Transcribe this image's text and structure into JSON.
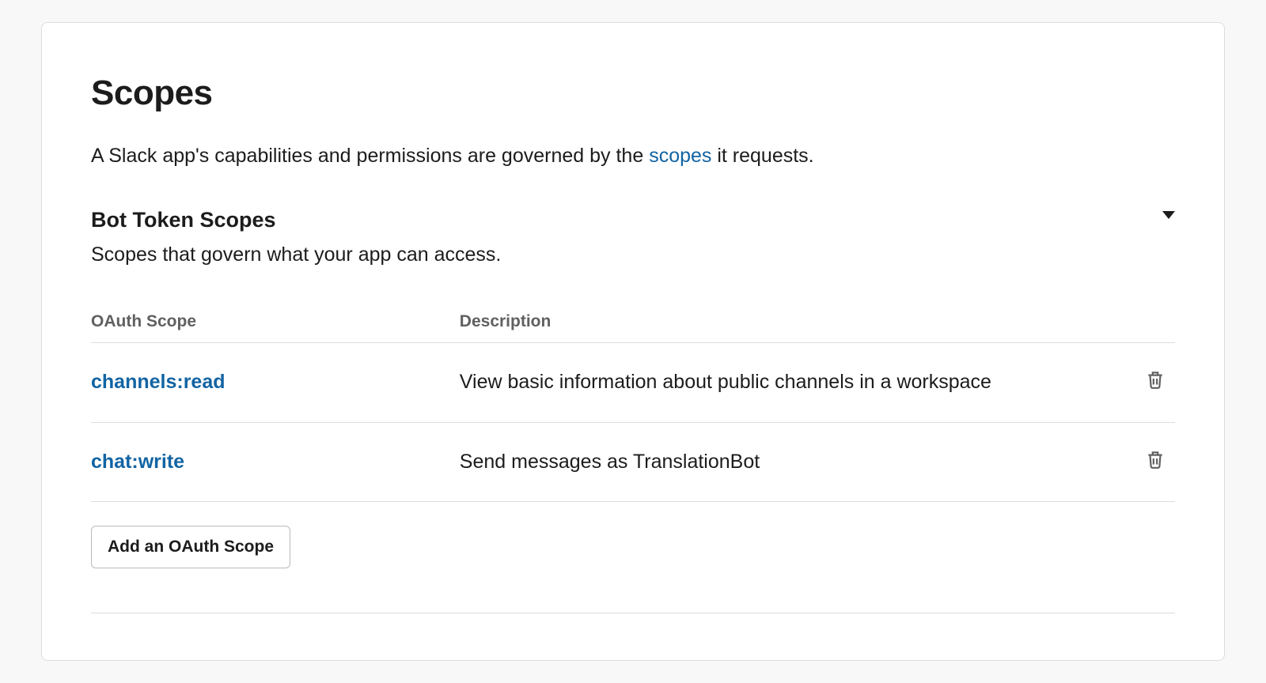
{
  "pageTitle": "Scopes",
  "introPrefix": "A Slack app's capabilities and permissions are governed by the ",
  "introLinkText": "scopes",
  "introSuffix": " it requests.",
  "botScopes": {
    "title": "Bot Token Scopes",
    "subtitle": "Scopes that govern what your app can access.",
    "columns": {
      "scope": "OAuth Scope",
      "description": "Description"
    },
    "rows": [
      {
        "scope": "channels:read",
        "description": "View basic information about public channels in a workspace"
      },
      {
        "scope": "chat:write",
        "description": "Send messages as TranslationBot"
      }
    ],
    "addButton": "Add an OAuth Scope"
  }
}
